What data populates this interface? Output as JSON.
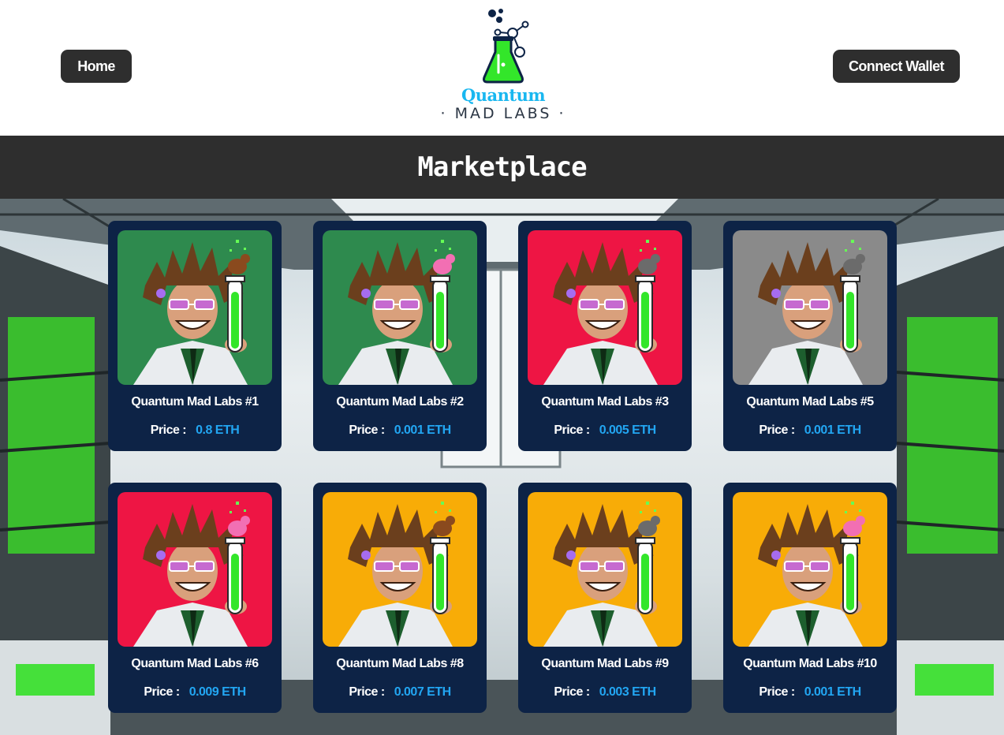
{
  "header": {
    "home_label": "Home",
    "connect_wallet_label": "Connect Wallet",
    "logo": {
      "line1": "Quantum",
      "line2": "· MAD LABS ·"
    }
  },
  "banner": {
    "title": "Marketplace"
  },
  "colors": {
    "button_bg": "#2e2e2e",
    "card_bg": "#0d2346",
    "price_accent": "#22a6f2",
    "logo_blue": "#19b7f0",
    "flask_green": "#33e62a"
  },
  "cards": [
    {
      "name": "Quantum Mad Labs #1",
      "price_label": "Price :",
      "price": "0.8 ETH",
      "art_bg": "#2e8a4e",
      "companion": "brown-creature"
    },
    {
      "name": "Quantum Mad Labs #2",
      "price_label": "Price :",
      "price": "0.001 ETH",
      "art_bg": "#2e8a4e",
      "companion": "pink-creature"
    },
    {
      "name": "Quantum Mad Labs #3",
      "price_label": "Price :",
      "price": "0.005 ETH",
      "art_bg": "#ee1544",
      "companion": "gray-creature"
    },
    {
      "name": "Quantum Mad Labs #5",
      "price_label": "Price :",
      "price": "0.001 ETH",
      "art_bg": "#8a8a8a",
      "companion": "gray-creature"
    },
    {
      "name": "Quantum Mad Labs #6",
      "price_label": "Price :",
      "price": "0.009 ETH",
      "art_bg": "#ee1544",
      "companion": "pink-creature"
    },
    {
      "name": "Quantum Mad Labs #8",
      "price_label": "Price :",
      "price": "0.007 ETH",
      "art_bg": "#f8ac07",
      "companion": "brown-creature"
    },
    {
      "name": "Quantum Mad Labs #9",
      "price_label": "Price :",
      "price": "0.003 ETH",
      "art_bg": "#f8ac07",
      "companion": "gray-creature"
    },
    {
      "name": "Quantum Mad Labs #10",
      "price_label": "Price :",
      "price": "0.001 ETH",
      "art_bg": "#f8ac07",
      "companion": "pink-creature"
    }
  ]
}
